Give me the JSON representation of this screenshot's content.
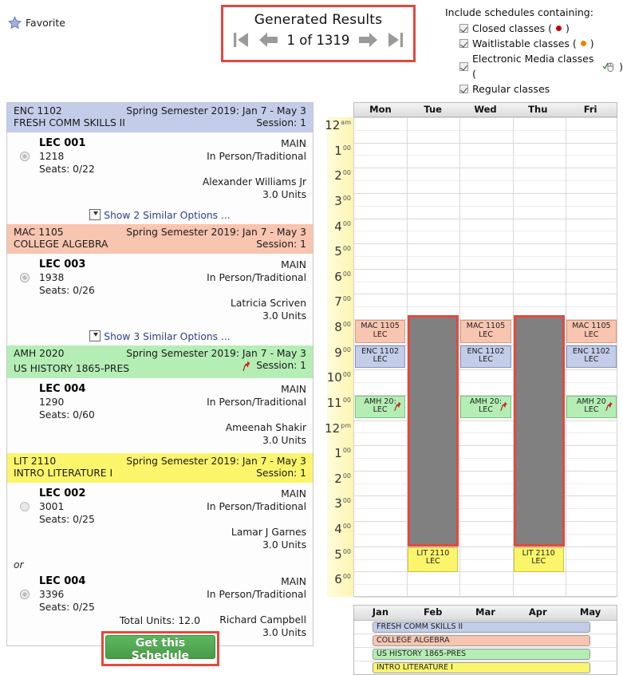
{
  "favorite": {
    "label": "Favorite",
    "icon": "star-icon"
  },
  "generated": {
    "title": "Generated Results",
    "counter": "1 of 1319",
    "first_icon": "first-page-icon",
    "prev_icon": "previous-arrow-icon",
    "next_icon": "next-arrow-icon",
    "last_icon": "last-page-icon"
  },
  "include": {
    "heading": "Include schedules containing:",
    "options": [
      {
        "label": "Closed classes (",
        "suffix": ")",
        "marker": "red-dot",
        "checked": true
      },
      {
        "label": "Waitlistable classes (",
        "suffix": ")",
        "marker": "orange-dot",
        "checked": true
      },
      {
        "label": "Electronic Media classes (",
        "suffix": ")",
        "marker": "mouse-check-icon",
        "checked": true
      },
      {
        "label": "Regular classes",
        "suffix": "",
        "marker": "none",
        "checked": true
      }
    ]
  },
  "courses": [
    {
      "code": "ENC 1102",
      "title": "FRESH COMM SKILLS II",
      "term": "Spring Semester 2019: Jan 7 - May 3",
      "session": "Session: 1",
      "color": "blue",
      "pinned": false,
      "sections": [
        {
          "lec": "LEC 001",
          "crn": "1218",
          "seats": "Seats: 0/22",
          "campus": "MAIN",
          "mode": "In Person/Traditional",
          "instructor": "Alexander Williams Jr",
          "units": "3.0 Units",
          "selected": true,
          "radio": true
        }
      ],
      "similar": "Show 2 Similar Options ..."
    },
    {
      "code": "MAC 1105",
      "title": "COLLEGE ALGEBRA",
      "term": "Spring Semester 2019: Jan 7 - May 3",
      "session": "Session: 1",
      "color": "orange",
      "pinned": false,
      "sections": [
        {
          "lec": "LEC 003",
          "crn": "1938",
          "seats": "Seats: 0/26",
          "campus": "MAIN",
          "mode": "In Person/Traditional",
          "instructor": "Latricia Scriven",
          "units": "3.0 Units",
          "selected": true,
          "radio": true
        }
      ],
      "similar": "Show 3 Similar Options ..."
    },
    {
      "code": "AMH 2020",
      "title": "US HISTORY 1865-PRES",
      "term": "Spring Semester 2019: Jan 7 - May 3",
      "session": "Session: 1",
      "color": "green",
      "pinned": true,
      "sections": [
        {
          "lec": "LEC 004",
          "crn": "1290",
          "seats": "Seats: 0/60",
          "campus": "MAIN",
          "mode": "In Person/Traditional",
          "instructor": "Ameenah Shakir",
          "units": "3.0 Units",
          "selected": false,
          "radio": false
        }
      ],
      "similar": ""
    },
    {
      "code": "LIT 2110",
      "title": "INTRO LITERATURE I",
      "term": "Spring Semester 2019: Jan 7 - May 3",
      "session": "Session: 1",
      "color": "yellow",
      "pinned": false,
      "or_label": "or",
      "sections": [
        {
          "lec": "LEC 002",
          "crn": "3001",
          "seats": "Seats: 0/25",
          "campus": "MAIN",
          "mode": "In Person/Traditional",
          "instructor": "Lamar J Garnes",
          "units": "3.0 Units",
          "selected": false,
          "radio": true
        },
        {
          "lec": "LEC 004",
          "crn": "3396",
          "seats": "Seats: 0/25",
          "campus": "MAIN",
          "mode": "In Person/Traditional",
          "instructor": "Richard Campbell",
          "units": "3.0 Units",
          "selected": true,
          "radio": true
        }
      ],
      "similar": ""
    }
  ],
  "total_units": "Total Units: 12.0",
  "get_schedule_button": "Get this Schedule",
  "calendar": {
    "days": [
      "Mon",
      "Tue",
      "Wed",
      "Thu",
      "Fri"
    ],
    "hours": [
      {
        "n": "12",
        "sup": "am"
      },
      {
        "n": "1",
        "sup": "00"
      },
      {
        "n": "2",
        "sup": "00"
      },
      {
        "n": "3",
        "sup": "00"
      },
      {
        "n": "4",
        "sup": "00"
      },
      {
        "n": "5",
        "sup": "00"
      },
      {
        "n": "6",
        "sup": "00"
      },
      {
        "n": "7",
        "sup": "00"
      },
      {
        "n": "8",
        "sup": "00"
      },
      {
        "n": "9",
        "sup": "00"
      },
      {
        "n": "10",
        "sup": "00"
      },
      {
        "n": "11",
        "sup": "00"
      },
      {
        "n": "12",
        "sup": "pm"
      },
      {
        "n": "1",
        "sup": "00"
      },
      {
        "n": "2",
        "sup": "00"
      },
      {
        "n": "3",
        "sup": "00"
      },
      {
        "n": "4",
        "sup": "00"
      },
      {
        "n": "5",
        "sup": "00"
      },
      {
        "n": "6",
        "sup": "00"
      }
    ],
    "events": [
      {
        "code": "MAC 1105",
        "type": "LEC",
        "day": 0,
        "color": "orange",
        "start": 8.0,
        "end": 8.9,
        "pin": false
      },
      {
        "code": "ENC 1102",
        "type": "LEC",
        "day": 0,
        "color": "blue",
        "start": 9.0,
        "end": 9.9,
        "pin": false
      },
      {
        "code": "AMH 20:",
        "type": "LEC",
        "day": 0,
        "color": "green",
        "start": 11.0,
        "end": 11.9,
        "pin": true
      },
      {
        "code": "MAC 1105",
        "type": "LEC",
        "day": 2,
        "color": "orange",
        "start": 8.0,
        "end": 8.9,
        "pin": false
      },
      {
        "code": "ENC 1102",
        "type": "LEC",
        "day": 2,
        "color": "blue",
        "start": 9.0,
        "end": 9.9,
        "pin": false
      },
      {
        "code": "AMH 20:",
        "type": "LEC",
        "day": 2,
        "color": "green",
        "start": 11.0,
        "end": 11.9,
        "pin": true
      },
      {
        "code": "MAC 1105",
        "type": "LEC",
        "day": 4,
        "color": "orange",
        "start": 8.0,
        "end": 8.9,
        "pin": false
      },
      {
        "code": "ENC 1102",
        "type": "LEC",
        "day": 4,
        "color": "blue",
        "start": 9.0,
        "end": 9.9,
        "pin": false
      },
      {
        "code": "AMH 20",
        "type": "LEC",
        "day": 4,
        "color": "green",
        "start": 11.0,
        "end": 11.9,
        "pin": true
      },
      {
        "code": "LIT 2110",
        "type": "LEC",
        "day": 1,
        "color": "yellow",
        "start": 17.0,
        "end": 18.0,
        "pin": false
      },
      {
        "code": "LIT 2110",
        "type": "LEC",
        "day": 3,
        "color": "yellow",
        "start": 17.0,
        "end": 18.0,
        "pin": false
      }
    ],
    "blocked": [
      {
        "day": 1,
        "start": 7.85,
        "end": 17.0
      },
      {
        "day": 3,
        "start": 7.85,
        "end": 17.0
      }
    ]
  },
  "semester_bar": {
    "months": [
      "Jan",
      "Feb",
      "Mar",
      "Apr",
      "May"
    ],
    "rows": [
      {
        "label": "FRESH COMM SKILLS II",
        "color": "blue",
        "start_pct": 7,
        "width_pct": 83
      },
      {
        "label": "COLLEGE ALGEBRA",
        "color": "orange",
        "start_pct": 7,
        "width_pct": 83
      },
      {
        "label": "US HISTORY 1865-PRES",
        "color": "green",
        "start_pct": 7,
        "width_pct": 83
      },
      {
        "label": "INTRO LITERATURE I",
        "color": "yellow",
        "start_pct": 7,
        "width_pct": 83
      }
    ]
  },
  "colors": {
    "blue": "#c3cce8",
    "orange": "#f8c5b0",
    "green": "#b4eeb4",
    "yellow": "#fbf56c",
    "highlight": "#e04a3f",
    "blocked": "#808080",
    "green_button": "#5cb85c"
  }
}
